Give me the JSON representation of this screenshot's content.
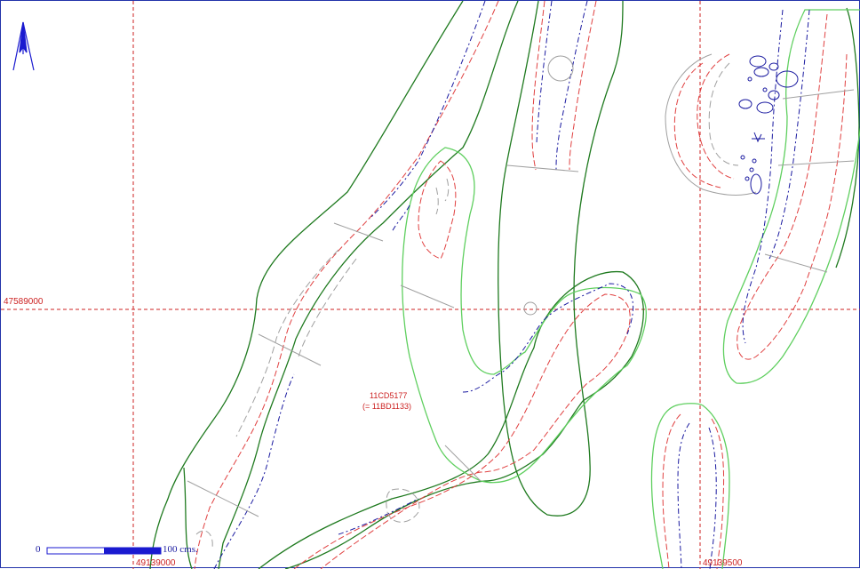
{
  "map": {
    "grid_labels": {
      "northing_left": "47589000",
      "easting_bottom_left": "49139000",
      "easting_bottom_right": "49139500"
    },
    "feature_label": {
      "id": "11CD5177",
      "alias": "(= 11BD1133)"
    },
    "scale_bar": {
      "start": "0",
      "end": "100",
      "unit": "cms."
    },
    "north_arrow": "north-arrow-icon",
    "colors": {
      "grid": "#cc2222",
      "outline_dark": "#1f7a1f",
      "outline_light": "#5fcf5f",
      "contour_red": "#e04040",
      "contour_blue": "#1a1aa0",
      "contour_gray": "#a0a0a0",
      "scale": "#1a1ad0"
    }
  }
}
